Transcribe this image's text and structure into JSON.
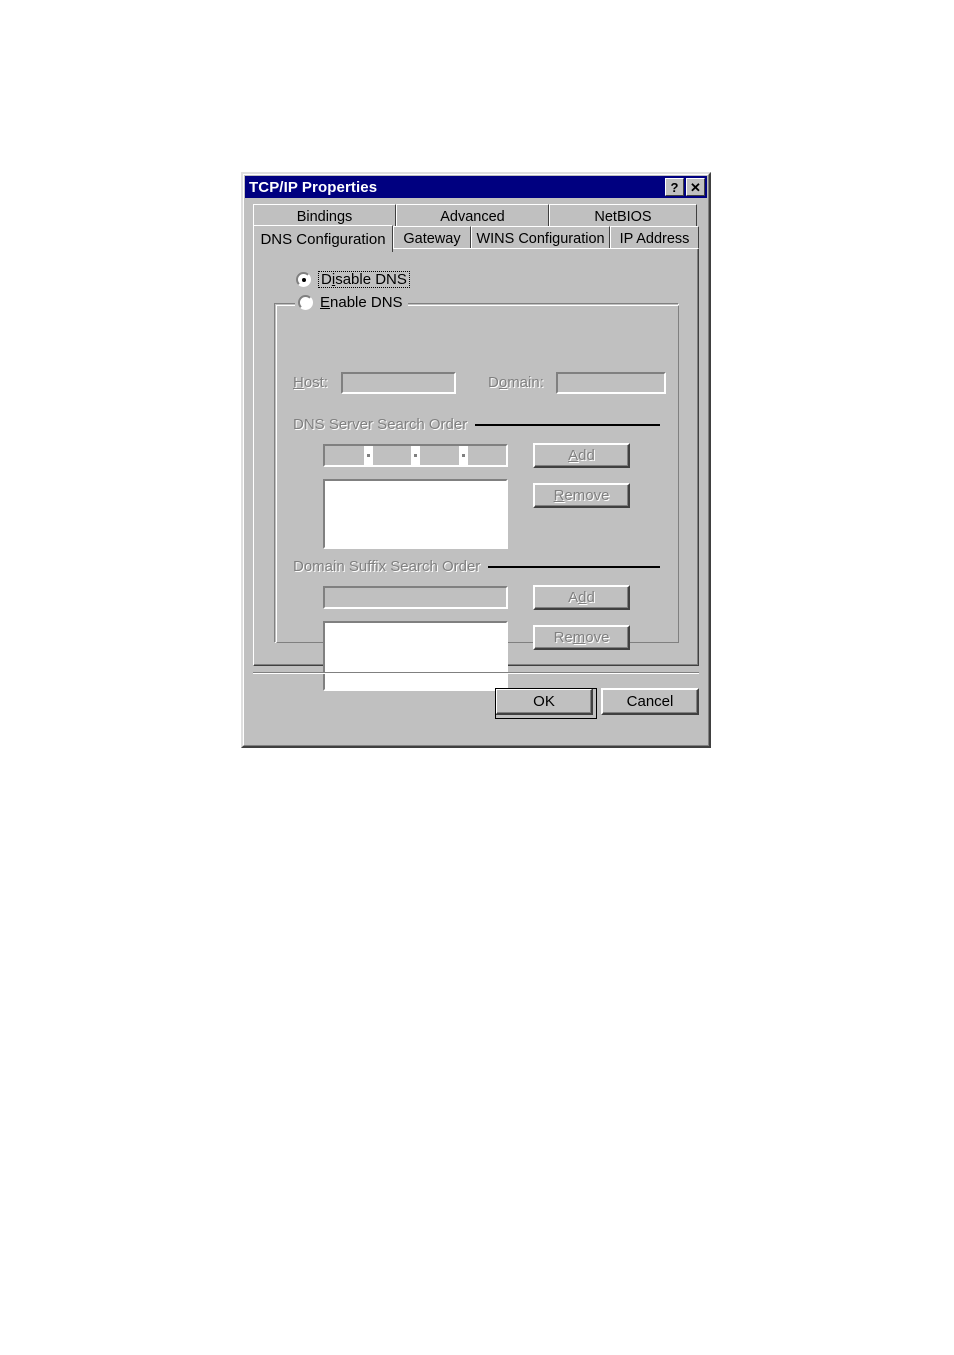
{
  "window": {
    "title": "TCP/IP Properties",
    "help_button": "?",
    "close_button": "✕",
    "help_icon_name": "help-icon",
    "close_icon_name": "close-icon",
    "titlebar_color": "#000080",
    "titlebar_text_color": "#ffffff",
    "face_color": "#c0c0c0",
    "disabled_text_color": "#808080"
  },
  "tabs": {
    "rows": [
      [
        {
          "label": "Bindings",
          "active": false
        },
        {
          "label": "Advanced",
          "active": false
        },
        {
          "label": "NetBIOS",
          "active": false
        }
      ],
      [
        {
          "label": "DNS Configuration",
          "active": true
        },
        {
          "label": "Gateway",
          "active": false
        },
        {
          "label": "WINS Configuration",
          "active": false
        },
        {
          "label": "IP Address",
          "active": false
        }
      ]
    ],
    "active_tab": "DNS Configuration"
  },
  "dns_panel": {
    "disable_dns": {
      "label_prefix": "D",
      "label_accel": "i",
      "label_suffix": "sable DNS",
      "selected": true,
      "focused": true
    },
    "enable_dns": {
      "label_prefix": "",
      "label_accel": "E",
      "label_suffix": "nable DNS",
      "selected": false,
      "enabled": false
    },
    "host": {
      "label_prefix": "",
      "label_accel": "H",
      "label_suffix": "ost:",
      "value": "",
      "enabled": false
    },
    "domain": {
      "label_prefix": "D",
      "label_accel": "o",
      "label_suffix": "main:",
      "value": "",
      "enabled": false
    },
    "dns_server_search_order": {
      "title": "DNS Server Search Order",
      "ip_value": [
        "",
        "",
        "",
        ""
      ],
      "ip_separator": ".",
      "list_items": [],
      "add_button": {
        "prefix": "",
        "accel": "A",
        "suffix": "dd",
        "enabled": false
      },
      "remove_button": {
        "prefix": "",
        "accel": "R",
        "suffix": "emove",
        "enabled": false
      }
    },
    "domain_suffix_search_order": {
      "title": "Domain Suffix Search Order",
      "input_value": "",
      "list_items": [],
      "add_button": {
        "prefix": "A",
        "accel": "d",
        "suffix": "d",
        "enabled": false
      },
      "remove_button": {
        "prefix": "Re",
        "accel": "m",
        "suffix": "ove",
        "enabled": false
      }
    }
  },
  "footer": {
    "ok_label": "OK",
    "cancel_label": "Cancel",
    "default_button": "OK"
  }
}
